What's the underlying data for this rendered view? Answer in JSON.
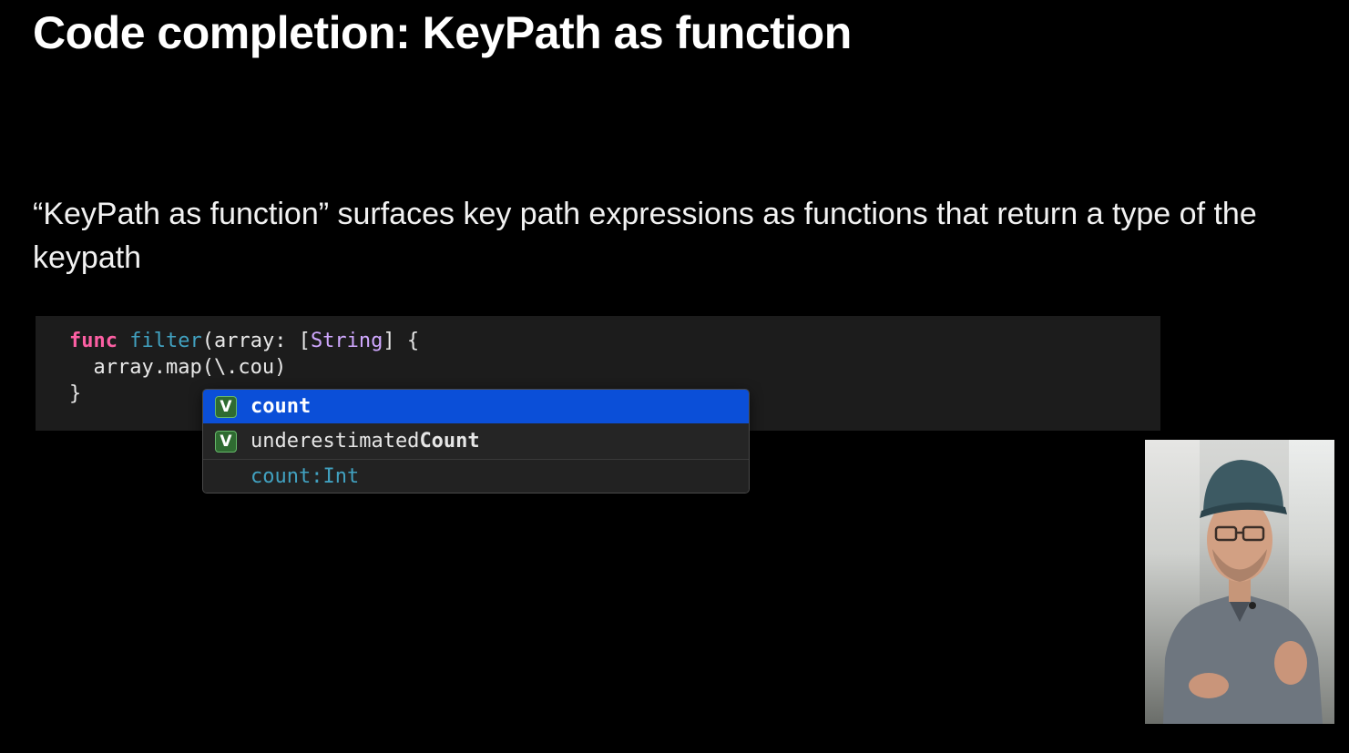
{
  "title": "Code completion: KeyPath as function",
  "description": "“KeyPath as function” surfaces key path expressions as functions that return a type of the keypath",
  "code": {
    "line1": {
      "keyword": "func",
      "name": "filter",
      "before_type": "(array: [",
      "type": "String",
      "after_type": "] {"
    },
    "line2": "  array.map(\\.cou)",
    "line3": "}"
  },
  "completions": {
    "items": [
      {
        "badge": "V",
        "label": "count",
        "selected": true
      },
      {
        "badge": "V",
        "label_prefix": "underestimated",
        "label_bold": "Count",
        "selected": false
      }
    ],
    "detail": {
      "name": "count:",
      "type": "Int"
    }
  },
  "presenter_video": {
    "icon": "presenter-video-thumbnail"
  },
  "colors": {
    "keyword": "#fc5fa3",
    "function": "#41a1c0",
    "type": "#d0a8ff",
    "selection": "#0b4fd8",
    "badge": "#2f6b31"
  }
}
